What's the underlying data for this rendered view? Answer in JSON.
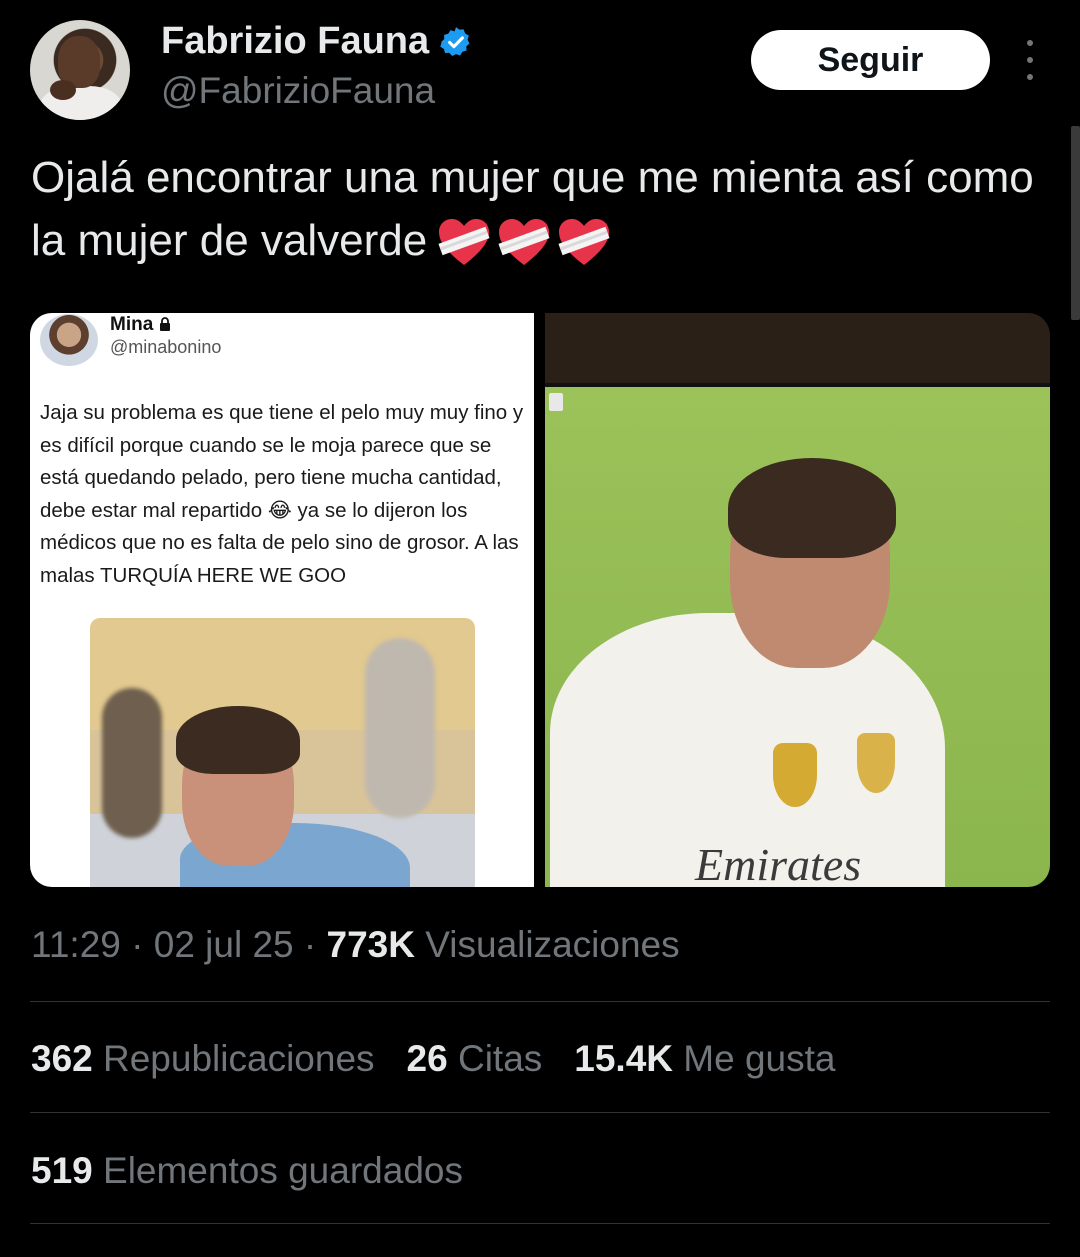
{
  "author": {
    "name": "Fabrizio Fauna",
    "handle": "@FabrizioFauna",
    "verified_icon": "verified-badge-icon",
    "verified_color": "#1d9bf0"
  },
  "follow_label": "Seguir",
  "tweet_text": "Ojalá encontrar una mujer que me mienta así como la mujer de valverde",
  "emoji": [
    "heart-bandaged",
    "heart-bandaged",
    "heart-bandaged"
  ],
  "embedded": {
    "name": "Mina",
    "handle": "@minabonino",
    "text": "Jaja su problema es que tiene el pelo muy muy fino y es difícil porque cuando se le moja parece que se está quedando pelado, pero tiene mucha cantidad, debe estar mal repartido 😂 ya se lo dijeron los médicos que no es falta de pelo sino de grosor. A las malas TURQUÍA HERE WE GOO",
    "sponsor_text": "Emirates"
  },
  "meta": {
    "time": "11:29",
    "sep1": " · ",
    "date": "02 jul 25",
    "sep2": " · ",
    "views_count": "773K",
    "views_label": " Visualizaciones"
  },
  "stats": {
    "reposts_count": "362",
    "reposts_label": " Republicaciones",
    "quotes_count": "26",
    "quotes_label": " Citas",
    "likes_count": "15.4K",
    "likes_label": " Me gusta",
    "bookmarks_count": "519",
    "bookmarks_label": " Elementos guardados"
  }
}
